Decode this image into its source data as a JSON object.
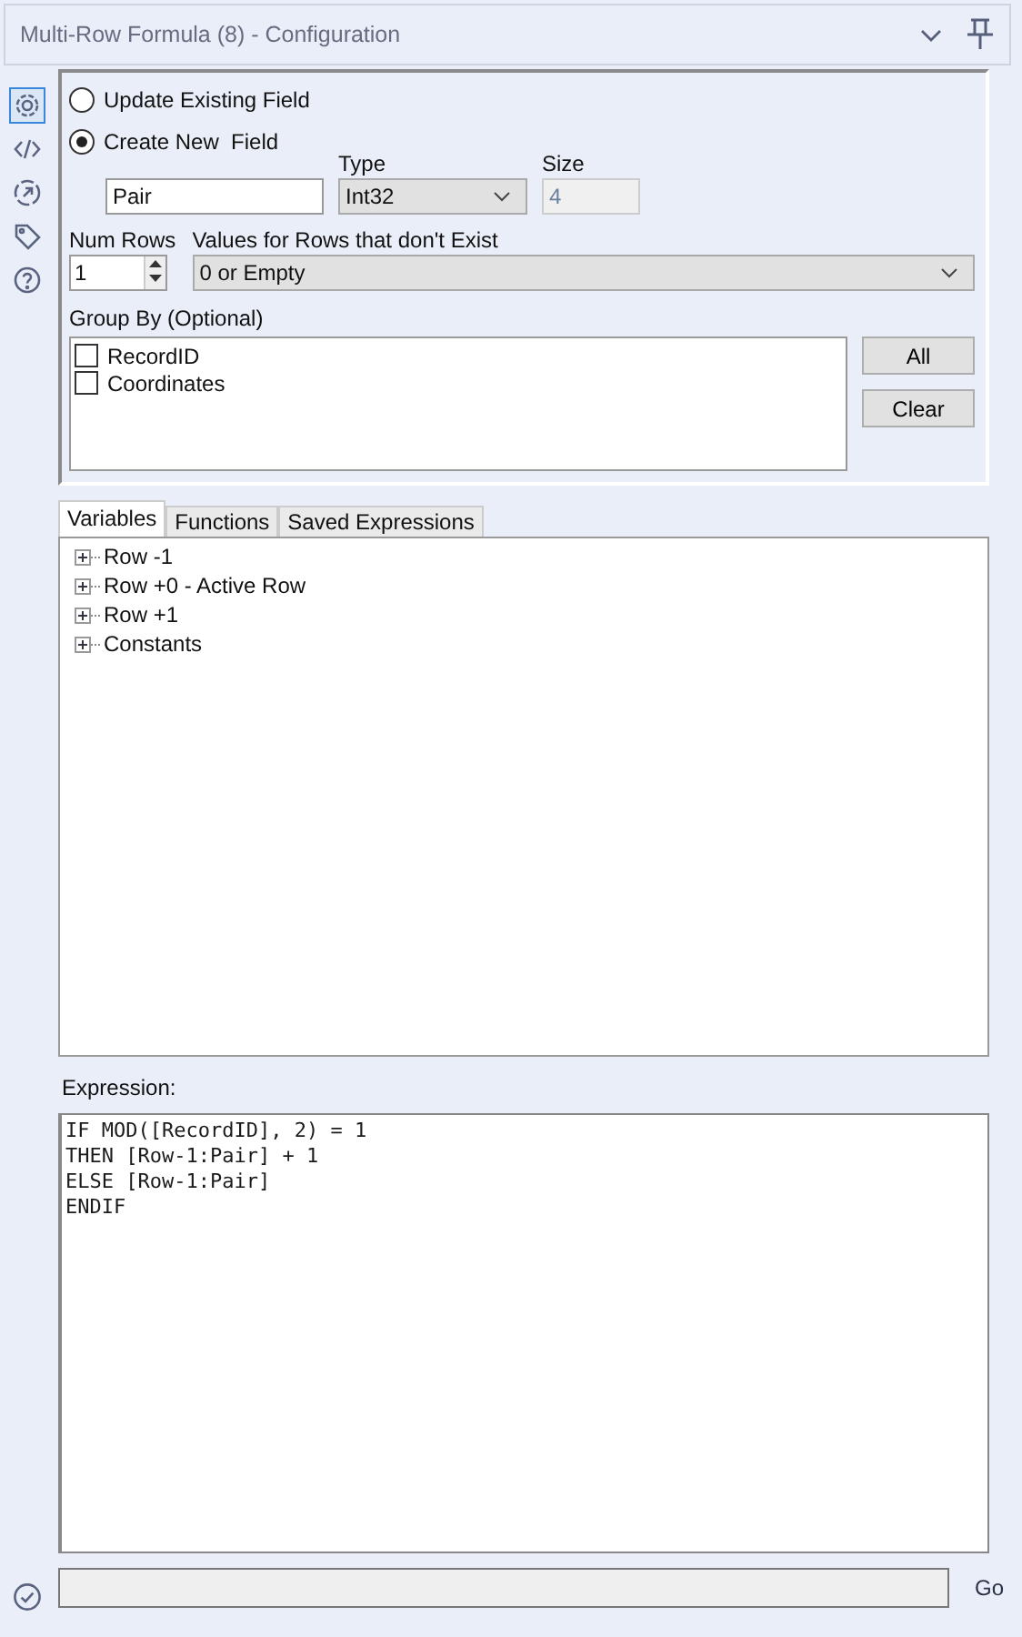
{
  "window": {
    "title": "Multi-Row Formula (8) - Configuration"
  },
  "sidebar": [
    {
      "kind": "settings",
      "selected": true
    },
    {
      "kind": "code",
      "selected": false
    },
    {
      "kind": "navigate",
      "selected": false
    },
    {
      "kind": "tag",
      "selected": false
    },
    {
      "kind": "help",
      "selected": false
    }
  ],
  "mode": [
    {
      "label": "Update Existing Field",
      "selected": false
    },
    {
      "label": "Create New  Field",
      "selected": true
    }
  ],
  "field": {
    "value": "Pair",
    "type_label": "Type",
    "type": "Int32",
    "size_label": "Size",
    "size": "4"
  },
  "num_rows": {
    "label": "Num Rows",
    "value": "1"
  },
  "missing_rows": {
    "label": "Values for Rows that don't Exist",
    "value": "0 or Empty"
  },
  "group_by": {
    "label": "Group By (Optional)",
    "items": [
      {
        "label": "RecordID",
        "checked": false
      },
      {
        "label": "Coordinates",
        "checked": false
      }
    ],
    "buttons": [
      "All",
      "Clear"
    ]
  },
  "tabs": [
    {
      "label": "Variables",
      "selected": true
    },
    {
      "label": "Functions",
      "selected": false
    },
    {
      "label": "Saved Expressions",
      "selected": false
    }
  ],
  "tree": [
    {
      "label": "Row -1",
      "expanded": false
    },
    {
      "label": "Row +0 - Active Row",
      "expanded": false
    },
    {
      "label": "Row +1",
      "expanded": false
    },
    {
      "label": "Constants",
      "expanded": false
    }
  ],
  "expression": {
    "label": "Expression:",
    "lines": [
      "IF MOD([RecordID], 2) = 1",
      "THEN [Row-1:Pair] + 1",
      "ELSE [Row-1:Pair]",
      "ENDIF"
    ]
  },
  "progress": {
    "level": 0
  },
  "go_button": "Go"
}
